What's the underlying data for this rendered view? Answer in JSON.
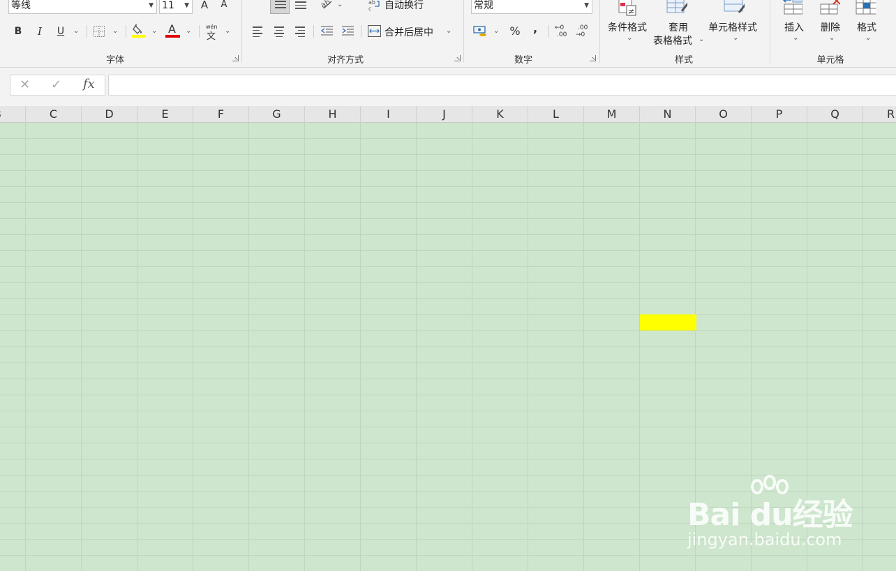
{
  "ribbon": {
    "font": {
      "font_name": "等线",
      "font_size": "11",
      "bold": "B",
      "italic": "I",
      "underline": "U",
      "grow_font": "A",
      "shrink_font": "A",
      "font_color_glyph": "A",
      "phonetic_glyph": "文",
      "phonetic_top": "wén",
      "group_label": "字体"
    },
    "alignment": {
      "wrap_text": "自动换行",
      "merge_center": "合并后居中",
      "group_label": "对齐方式"
    },
    "number": {
      "format": "常规",
      "percent": "%",
      "comma": ",",
      "inc_decimal_top": "←0",
      "inc_decimal_bottom": ".00",
      "dec_decimal_top": ".00",
      "dec_decimal_bottom": "→0",
      "group_label": "数字"
    },
    "styles": {
      "conditional_format": "条件格式",
      "table_format_line1": "套用",
      "table_format_line2": "表格格式",
      "cell_styles": "单元格样式",
      "group_label": "样式"
    },
    "cells": {
      "insert": "插入",
      "delete": "删除",
      "format": "格式",
      "group_label": "单元格"
    },
    "colors": {
      "highlight": "#ffff00",
      "font_color": "#e00000"
    }
  },
  "formula_bar": {
    "cancel_glyph": "✕",
    "enter_glyph": "✓",
    "fx_glyph": "fx",
    "value": ""
  },
  "sheet": {
    "columns": [
      "B",
      "C",
      "D",
      "E",
      "F",
      "G",
      "H",
      "I",
      "J",
      "K",
      "L",
      "M",
      "N",
      "O",
      "P",
      "Q",
      "R"
    ],
    "background": "#cde6cd",
    "highlight_fill": "#ffff00"
  },
  "watermark": {
    "brand": "Bai du经验",
    "url": "jingyan.baidu.com"
  }
}
